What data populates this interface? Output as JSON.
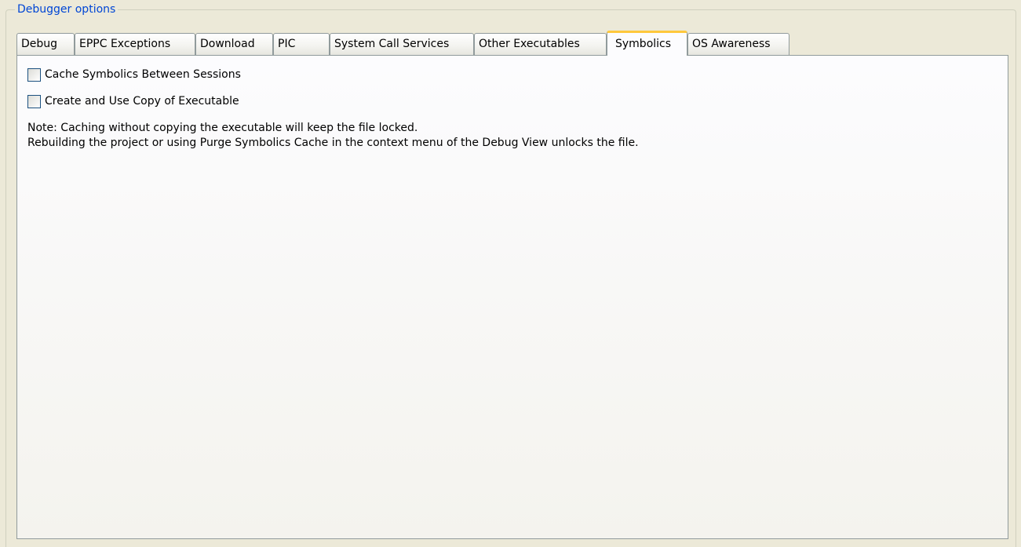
{
  "group": {
    "title": "Debugger options"
  },
  "tabs": [
    {
      "label": "Debug",
      "active": false
    },
    {
      "label": "EPPC Exceptions",
      "active": false
    },
    {
      "label": "Download",
      "active": false
    },
    {
      "label": "PIC",
      "active": false
    },
    {
      "label": "System Call Services",
      "active": false
    },
    {
      "label": "Other Executables",
      "active": false
    },
    {
      "label": "Symbolics",
      "active": true
    },
    {
      "label": "OS Awareness",
      "active": false
    }
  ],
  "panel": {
    "options": [
      {
        "label": "Cache Symbolics Between Sessions",
        "checked": false
      },
      {
        "label": "Create and Use Copy of Executable",
        "checked": false
      }
    ],
    "note": {
      "line1": "Note: Caching without copying the executable will keep the file locked.",
      "line2": "Rebuilding the project or using Purge Symbolics Cache in the context menu of the Debug View unlocks the file."
    }
  },
  "colors": {
    "legend_text": "#0046d5",
    "active_tab_highlight": "#ffc83c",
    "window_background": "#ece9d8"
  }
}
